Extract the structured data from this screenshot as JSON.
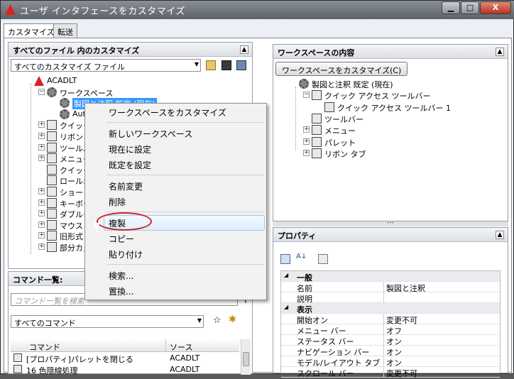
{
  "window": {
    "title": "ユーザ インタフェースをカスタマイズ",
    "minimize": "▁",
    "maximize": "□",
    "close": "X"
  },
  "tabs": [
    {
      "label": "カスタマイズ"
    },
    {
      "label": "転送"
    }
  ],
  "left_panel": {
    "header": "すべてのファイル 内のカスタマイズ",
    "file_combo": "すべてのカスタマイズ ファイル",
    "tree": [
      {
        "label": "ACADLT",
        "icon": "red-triangle-icon"
      },
      {
        "label": "ワークスペース",
        "icon": "gear-icon"
      },
      {
        "label": "製図と注釈 既定 (現在)",
        "icon": "gear-icon"
      },
      {
        "label": "Auto",
        "icon": "gear-icon"
      },
      {
        "label": "クイック ア",
        "icon": "toolbar-icon"
      },
      {
        "label": "リボン",
        "icon": "ribbon-icon"
      },
      {
        "label": "ツールバー",
        "icon": "toolbar-icon"
      },
      {
        "label": "メニュー",
        "icon": "menu-icon"
      },
      {
        "label": "クイック プ",
        "icon": "palette-icon"
      },
      {
        "label": "ロールオー",
        "icon": "rollover-icon"
      },
      {
        "label": "ショートカ",
        "icon": "shortcut-icon"
      },
      {
        "label": "キーボー",
        "icon": "keyboard-icon"
      },
      {
        "label": "ダブルクリ",
        "icon": "doubleclick-icon"
      },
      {
        "label": "マウス ボ",
        "icon": "mouse-icon"
      },
      {
        "label": "旧形式",
        "icon": "clock-icon"
      },
      {
        "label": "部分カス",
        "icon": "cui-icon"
      }
    ]
  },
  "commands": {
    "header": "コマンド一覧:",
    "search_placeholder": "コマンド一覧を検索",
    "filter": "すべてのコマンド",
    "columns": [
      "コマンド",
      "ソース"
    ],
    "rows": [
      {
        "command": "[プロパティ]パレットを閉じる",
        "source": "ACADLT"
      },
      {
        "command": "16 色隠線処理",
        "source": "ACADLT"
      }
    ]
  },
  "context_menu": {
    "items": [
      "ワークスペースをカスタマイズ",
      "新しいワークスペース",
      "現在に設定",
      "既定を設定",
      "名前変更",
      "削除",
      "複製",
      "コピー",
      "貼り付け",
      "検索...",
      "置換..."
    ],
    "highlighted": "複製"
  },
  "right_panel": {
    "header": "ワークスペースの内容",
    "button": "ワークスペースをカスタマイズ(C)",
    "tree": [
      {
        "label": "製図と注釈 既定 (現在)"
      },
      {
        "label": "クイック アクセス ツールバー"
      },
      {
        "label": "クイック アクセス ツールバー 1"
      },
      {
        "label": "ツールバー"
      },
      {
        "label": "メニュー"
      },
      {
        "label": "パレット"
      },
      {
        "label": "リボン タブ"
      }
    ]
  },
  "properties": {
    "header": "プロパティ",
    "rows": [
      {
        "type": "cat",
        "name": "一般",
        "value": ""
      },
      {
        "type": "prop",
        "name": "名前",
        "value": "製図と注釈"
      },
      {
        "type": "prop",
        "name": "説明",
        "value": ""
      },
      {
        "type": "cat",
        "name": "表示",
        "value": ""
      },
      {
        "type": "prop",
        "name": "開始オン",
        "value": "変更不可"
      },
      {
        "type": "prop",
        "name": "メニュー バー",
        "value": "オフ"
      },
      {
        "type": "prop",
        "name": "ステータス バー",
        "value": "オン"
      },
      {
        "type": "prop",
        "name": "ナビゲーション バー",
        "value": "オン"
      },
      {
        "type": "prop",
        "name": "モデル/レイアウト タブ",
        "value": "オン"
      },
      {
        "type": "prop",
        "name": "スクロール バー",
        "value": "変更不可"
      }
    ]
  },
  "colors": {
    "highlight_ring": "#c8262c",
    "selection": "#3399ff"
  }
}
